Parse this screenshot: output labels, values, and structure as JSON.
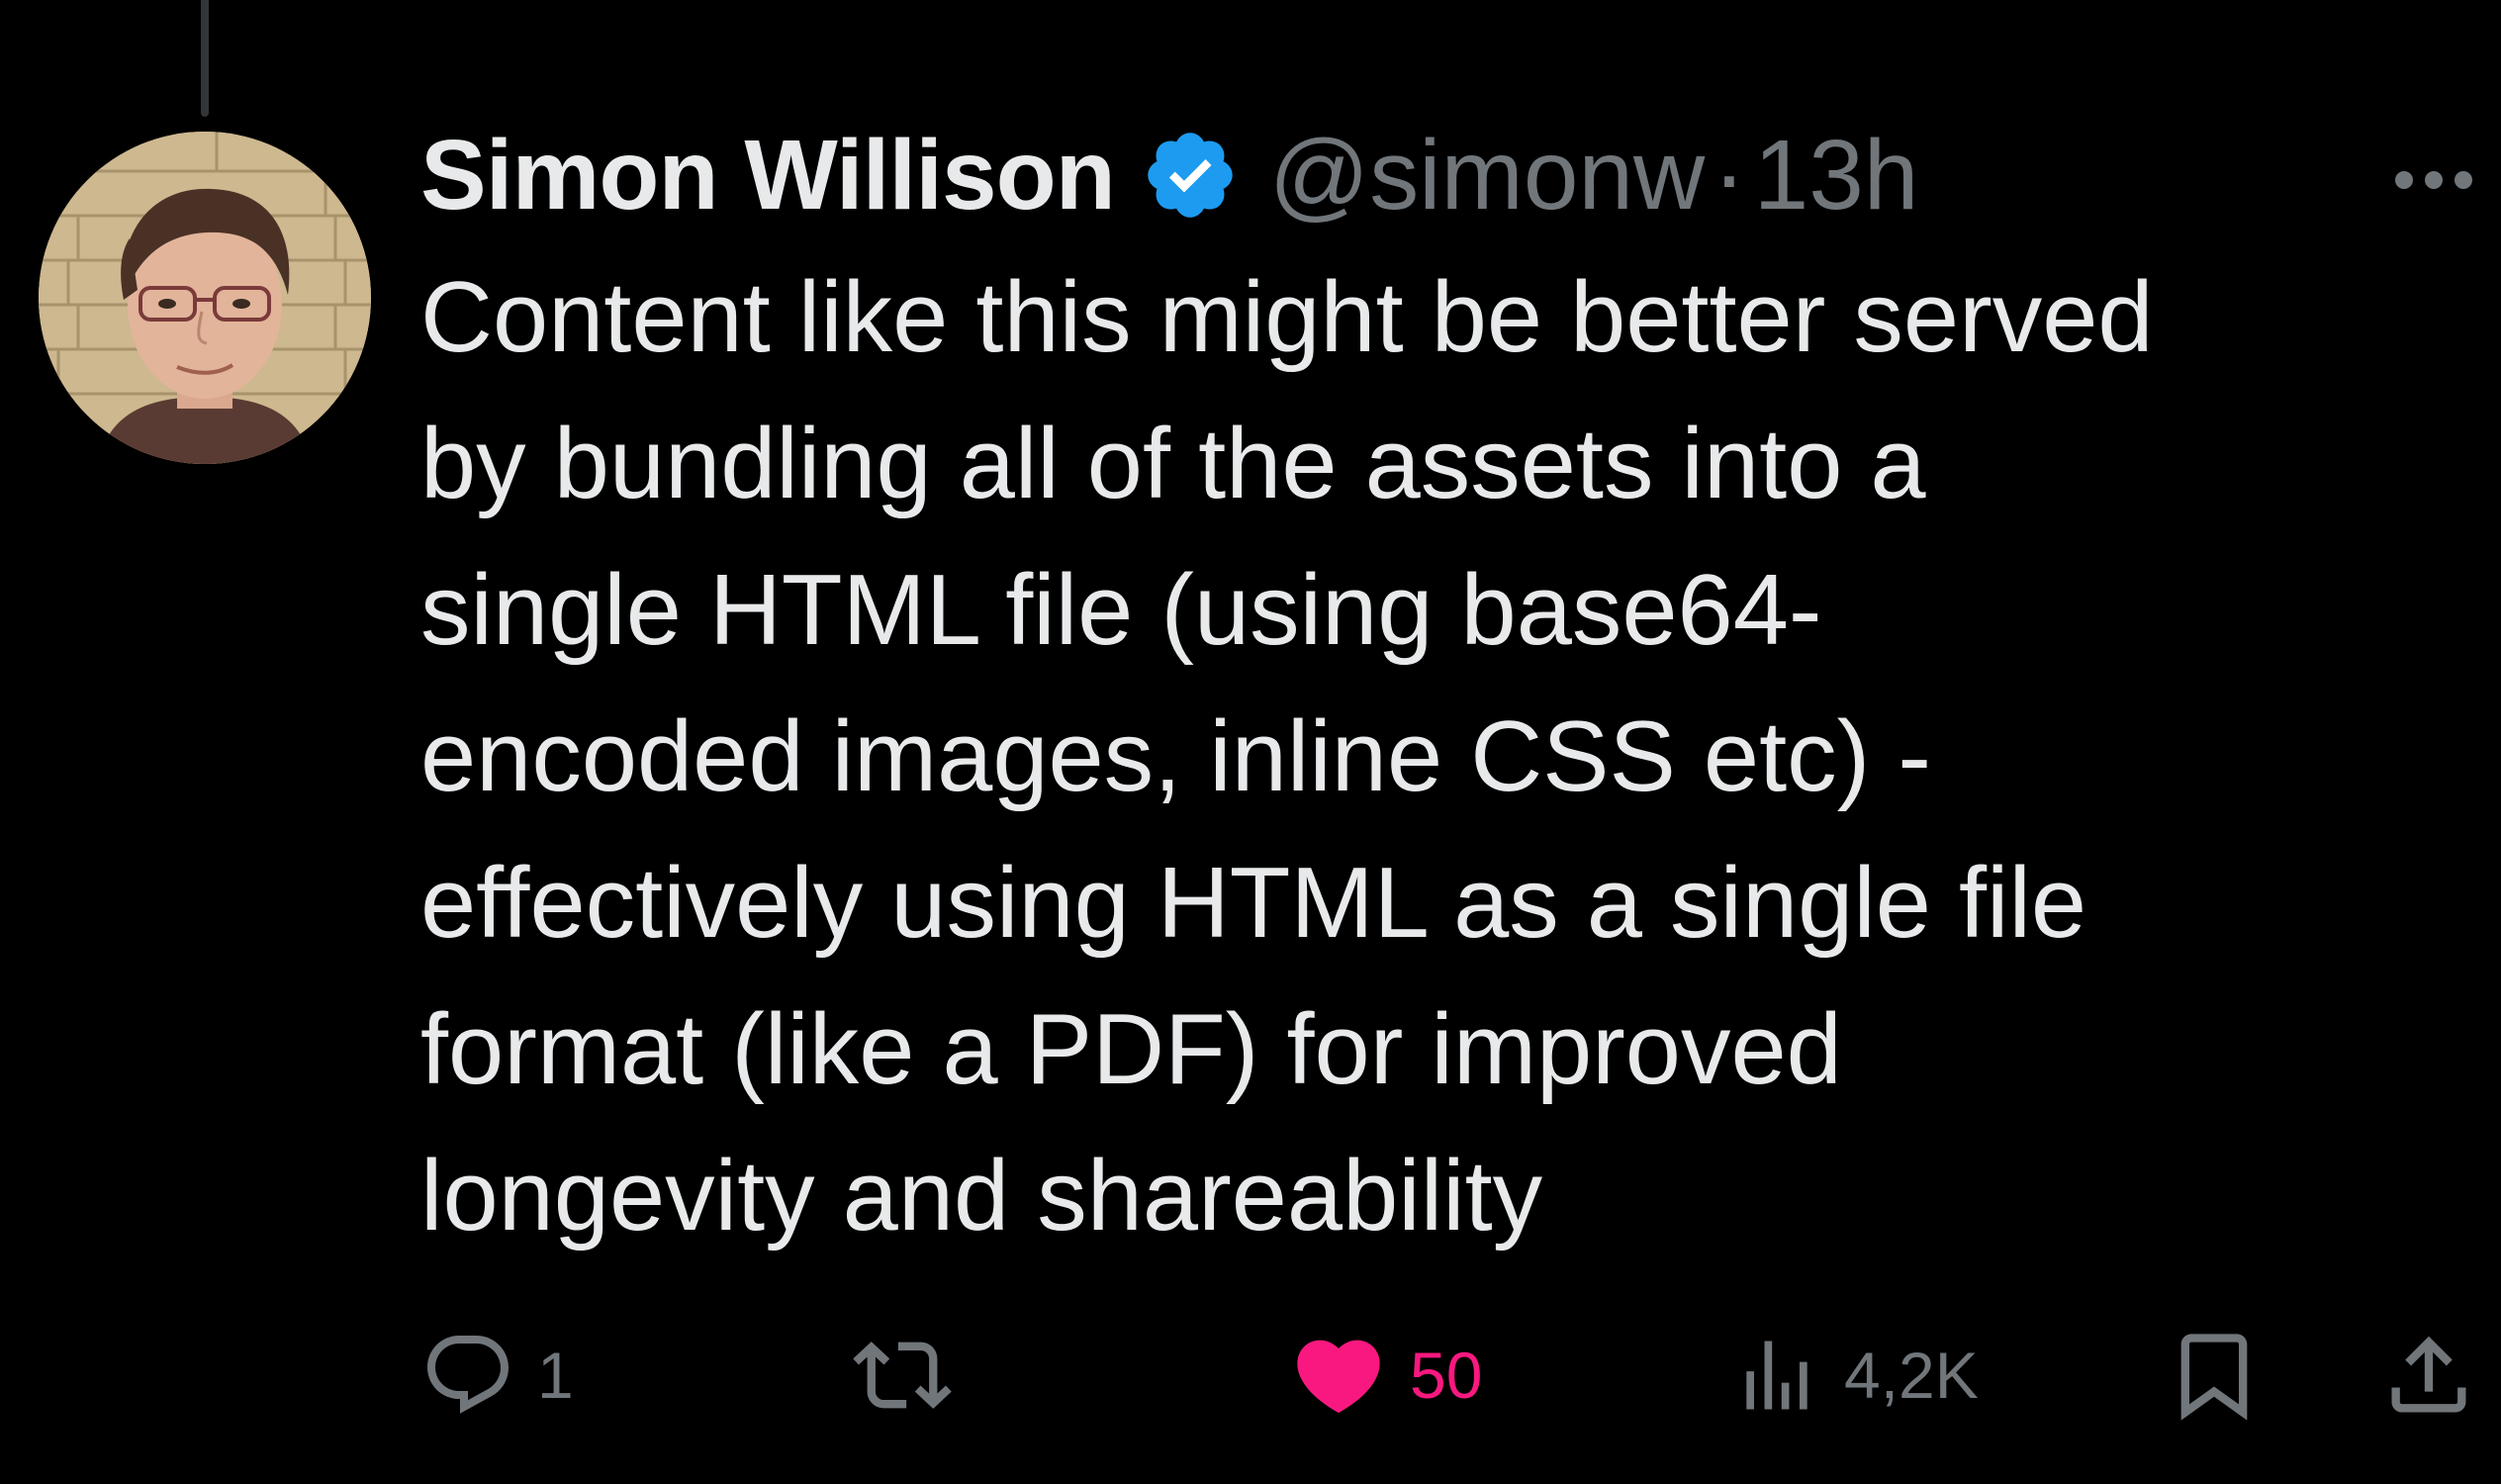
{
  "tweet": {
    "author": {
      "display_name": "Simon Willison",
      "handle": "@simonw",
      "verified": true
    },
    "separator": "·",
    "time": "13h",
    "text_lines": [
      "Content like this might be better served",
      "by bundling all of the assets into a",
      "single HTML file (using base64-",
      "encoded images, inline CSS etc) -",
      "effectively using HTML as a single file",
      "format (like a PDF) for improved",
      "longevity and shareability"
    ]
  },
  "actions": {
    "reply_count": "1",
    "retweet_count": "",
    "like_count": "50",
    "view_count": "4,2K"
  },
  "colors": {
    "background": "#000000",
    "text_primary": "#e7e9ea",
    "text_secondary": "#71767b",
    "verified_blue": "#1d9bf0",
    "like_pink": "#f91880",
    "thread_line": "#333639"
  },
  "icons": {
    "verified": "verified-badge-icon",
    "more": "more-dots-icon",
    "reply": "reply-bubble-icon",
    "retweet": "retweet-arrows-icon",
    "like": "heart-icon",
    "views": "analytics-bars-icon",
    "bookmark": "bookmark-icon",
    "share": "share-upload-icon"
  }
}
